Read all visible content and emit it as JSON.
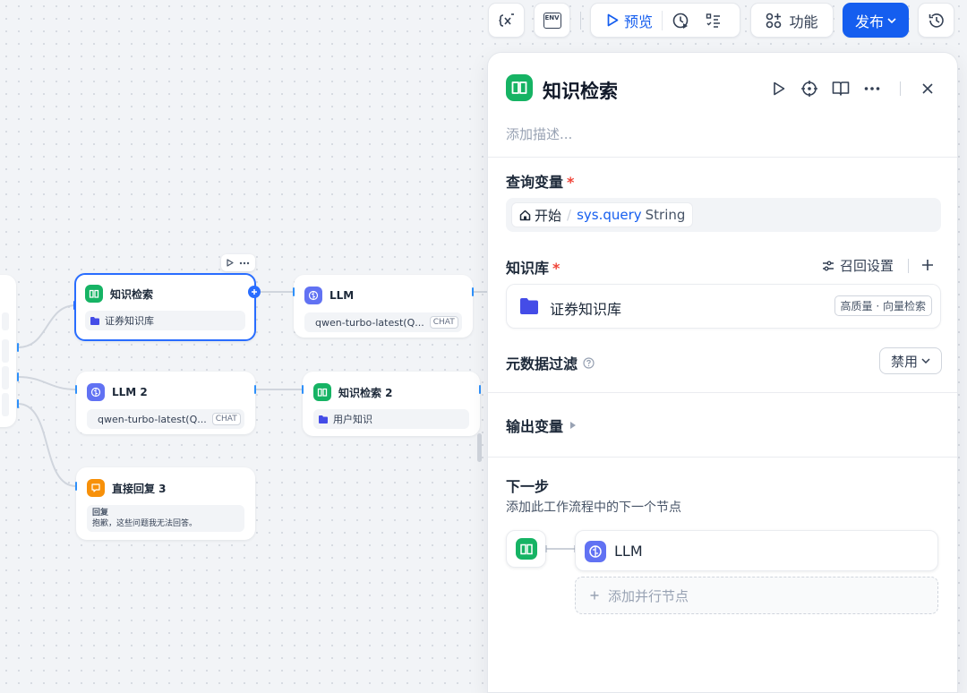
{
  "toolbar": {
    "env_label": "ENV",
    "preview_label": "预览",
    "features_label": "功能",
    "publish_label": "发布"
  },
  "canvas": {
    "node_kb1": {
      "title": "知识检索",
      "dataset": "证券知识库"
    },
    "node_llm1": {
      "title": "LLM",
      "model": "qwen-turbo-latest(Q...",
      "badge": "CHAT"
    },
    "node_llm2": {
      "title": "LLM 2",
      "model": "qwen-turbo-latest(Q...",
      "badge": "CHAT"
    },
    "node_kb2": {
      "title": "知识检索 2",
      "dataset": "用户知识"
    },
    "node_answer": {
      "title": "直接回复 3",
      "reply_label": "回复",
      "reply_text": "抱歉，这些问题我无法回答。"
    }
  },
  "panel": {
    "title": "知识检索",
    "description_placeholder": "添加描述...",
    "query_section": {
      "label": "查询变量",
      "required_mark": "*",
      "source_node": "开始",
      "separator": "/",
      "variable": "sys.query",
      "type": "String"
    },
    "kb_section": {
      "label": "知识库",
      "required_mark": "*",
      "recall_settings": "召回设置",
      "dataset_name": "证券知识库",
      "dataset_tag": "高质量 · 向量检索"
    },
    "metadata_section": {
      "label": "元数据过滤",
      "select_value": "禁用"
    },
    "output_section": {
      "label": "输出变量"
    },
    "next_section": {
      "label": "下一步",
      "description": "添加此工作流程中的下一个节点",
      "next_node": "LLM",
      "add_parallel": "添加并行节点"
    }
  },
  "colors": {
    "accent": "#155eef",
    "kb_green": "#16b364",
    "llm_purple": "#6172f3",
    "answer_orange": "#f79009",
    "required_red": "#f04438"
  }
}
